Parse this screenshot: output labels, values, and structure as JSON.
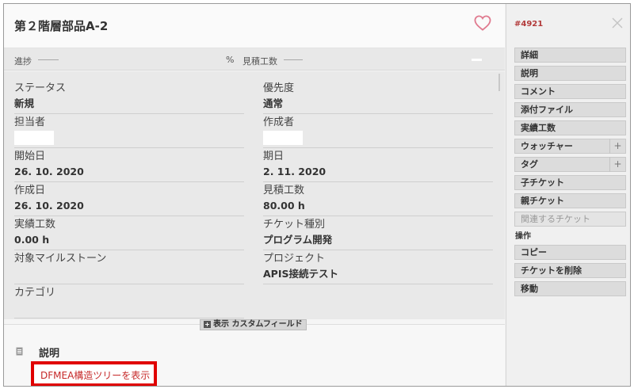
{
  "header": {
    "title": "第２階層部品A-2"
  },
  "progress": {
    "progress_label": "進捗",
    "percent_sign": "%",
    "estimate_label": "見積工数"
  },
  "fields": {
    "status": {
      "label": "ステータス",
      "value": "新規"
    },
    "priority": {
      "label": "優先度",
      "value": "通常"
    },
    "assignee": {
      "label": "担当者",
      "value": ""
    },
    "author": {
      "label": "作成者",
      "value": ""
    },
    "start_date": {
      "label": "開始日",
      "value": "26. 10. 2020"
    },
    "due_date": {
      "label": "期日",
      "value": "2. 11. 2020"
    },
    "created_date": {
      "label": "作成日",
      "value": "26. 10. 2020"
    },
    "estimated_hours": {
      "label": "見積工数",
      "value": "80.00 h"
    },
    "spent_hours": {
      "label": "実績工数",
      "value": "0.00 h"
    },
    "tracker": {
      "label": "チケット種別",
      "value": "プログラム開発"
    },
    "target_version": {
      "label": "対象マイルストーン",
      "value": ""
    },
    "project": {
      "label": "プロジェクト",
      "value": "APIS接続テスト"
    },
    "category": {
      "label": "カテゴリ",
      "value": ""
    }
  },
  "custom_fields_toggle": {
    "icon": "plus-box-icon",
    "label": "表示 カスタムフィールド"
  },
  "description": {
    "icon": "document-icon",
    "heading": "説明",
    "link": "DFMEA構造ツリーを表示"
  },
  "sidebar": {
    "ticket_number": "#4921",
    "close_icon": "close-icon",
    "buttons": [
      {
        "label": "詳細"
      },
      {
        "label": "説明"
      },
      {
        "label": "コメント"
      },
      {
        "label": "添付ファイル"
      },
      {
        "label": "実績工数"
      },
      {
        "label": "ウォッチャー",
        "plus": "+"
      },
      {
        "label": "タグ",
        "plus": "+"
      },
      {
        "label": "子チケット"
      },
      {
        "label": "親チケット"
      },
      {
        "label": "関連するチケット",
        "disabled": true
      }
    ],
    "actions_heading": "操作",
    "actions": [
      {
        "label": "コピー"
      },
      {
        "label": "チケットを削除"
      },
      {
        "label": "移動"
      }
    ]
  },
  "colors": {
    "heart": "#e07a8f",
    "ticket_number": "#b23a3a",
    "highlight_border": "#e00000",
    "link": "#c62828"
  }
}
